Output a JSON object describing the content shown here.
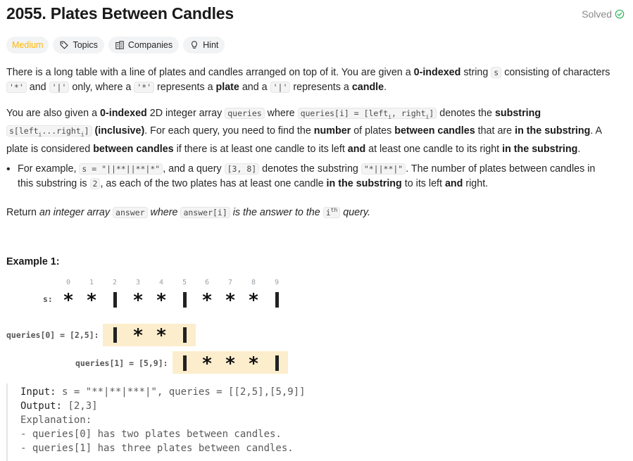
{
  "problem": {
    "title": "2055. Plates Between Candles",
    "status": "Solved",
    "difficulty": "Medium",
    "chips": [
      "Topics",
      "Companies",
      "Hint"
    ]
  },
  "description": {
    "p1_a": "There is a long table with a line of plates and candles arranged on top of it. You are given a ",
    "p1_b": "0-indexed",
    "p1_c": " string ",
    "p1_s": "s",
    "p1_d": " consisting of characters",
    "p1_star": "'*'",
    "p1_e": " and ",
    "p1_pipe": "'|'",
    "p1_f": " only, where a ",
    "p1_star2": "'*'",
    "p1_g": " represents a ",
    "p1_plate": "plate",
    "p1_h": " and a ",
    "p1_pipe2": "'|'",
    "p1_i": " represents a ",
    "p1_candle": "candle",
    "p1_j": ".",
    "p2_a": "You are also given a ",
    "p2_b": "0-indexed",
    "p2_c": " 2D integer array ",
    "p2_q": "queries",
    "p2_d": " where ",
    "p2_qi": "queries[i] = [left",
    "p2_qi_sub1": "i",
    "p2_qi2": ", right",
    "p2_qi_sub2": "i",
    "p2_qi3": "]",
    "p2_e": " denotes the ",
    "p2_substring": "substring",
    "p2_s1": "s[left",
    "p2_s1_sub": "i",
    "p2_s2": "...right",
    "p2_s2_sub": "i",
    "p2_s3": "]",
    "p2_f": " ",
    "p2_incl": "(inclusive)",
    "p2_g": ". For each query, you need to find the ",
    "p2_number": "number",
    "p2_h": " of plates ",
    "p2_between": "between candles",
    "p2_i": " that are ",
    "p2_inthe": "in the substring",
    "p2_j": ". A plate is considered ",
    "p2_between2": "between candles",
    "p2_k": " if there is at least one candle to its left ",
    "p2_and": "and",
    "p2_l": " at least one candle to its right ",
    "p2_inthe2": "in the substring",
    "p2_m": ".",
    "li_a": "For example, ",
    "li_code1": "s = \"||**||**|*\"",
    "li_b": ", and a query ",
    "li_code2": "[3, 8]",
    "li_c": " denotes the substring ",
    "li_code3": "\"*||**|\"",
    "li_d": ". The number of plates between candles in this substring is ",
    "li_code4": "2",
    "li_e": ", as each of the two plates has at least one candle ",
    "li_inthe": "in the substring",
    "li_f": " to its left ",
    "li_and": "and",
    "li_g": " right.",
    "ret_a": "Return ",
    "ret_b": "an integer array",
    "ret_code1": "answer",
    "ret_c": " where ",
    "ret_code2": "answer[i]",
    "ret_d": " is the answer to the ",
    "ret_code3": "i",
    "ret_code3_sup": "th",
    "ret_e": " query."
  },
  "example": {
    "title": "Example 1:",
    "indices": [
      "0",
      "1",
      "2",
      "3",
      "4",
      "5",
      "6",
      "7",
      "8",
      "9"
    ],
    "s_label": "s:",
    "q0_label": "queries[0] = [2,5]:",
    "q1_label": "queries[1] = [5,9]:",
    "input_label": "Input:",
    "input_value": " s = \"**|**|***|\", queries = [[2,5],[5,9]]",
    "output_label": "Output:",
    "output_value": " [2,3]",
    "explanation_label": "Explanation:",
    "explanation_1": "- queries[0] has two plates between candles.",
    "explanation_2": "- queries[1] has three plates between candles."
  },
  "colors": {
    "difficulty": "#ffb800",
    "solved_check": "#2db55d",
    "highlight": "#fcedcc"
  }
}
